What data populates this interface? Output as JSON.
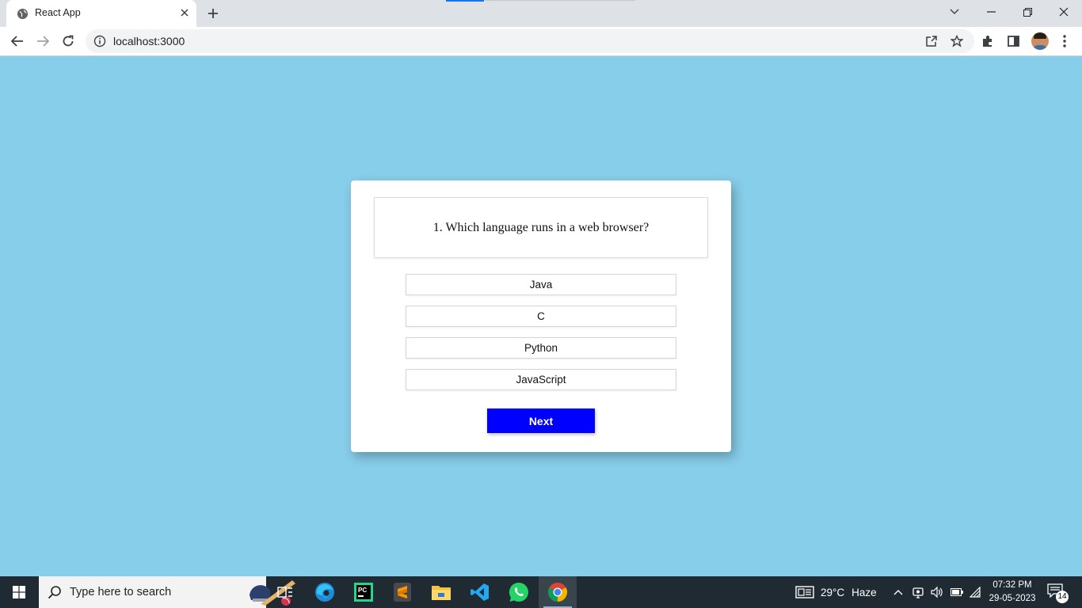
{
  "browser": {
    "tab_title": "React App",
    "url": "localhost:3000"
  },
  "quiz": {
    "question": "1. Which language runs in a web browser?",
    "options": [
      "Java",
      "C",
      "Python",
      "JavaScript"
    ],
    "next_label": "Next",
    "colors": {
      "background": "#87ceea",
      "next_button": "#0000ff"
    }
  },
  "taskbar": {
    "search_placeholder": "Type here to search",
    "weather_temp": "29°C",
    "weather_desc": "Haze",
    "time": "07:32 PM",
    "date": "29-05-2023",
    "notification_count": "14"
  }
}
